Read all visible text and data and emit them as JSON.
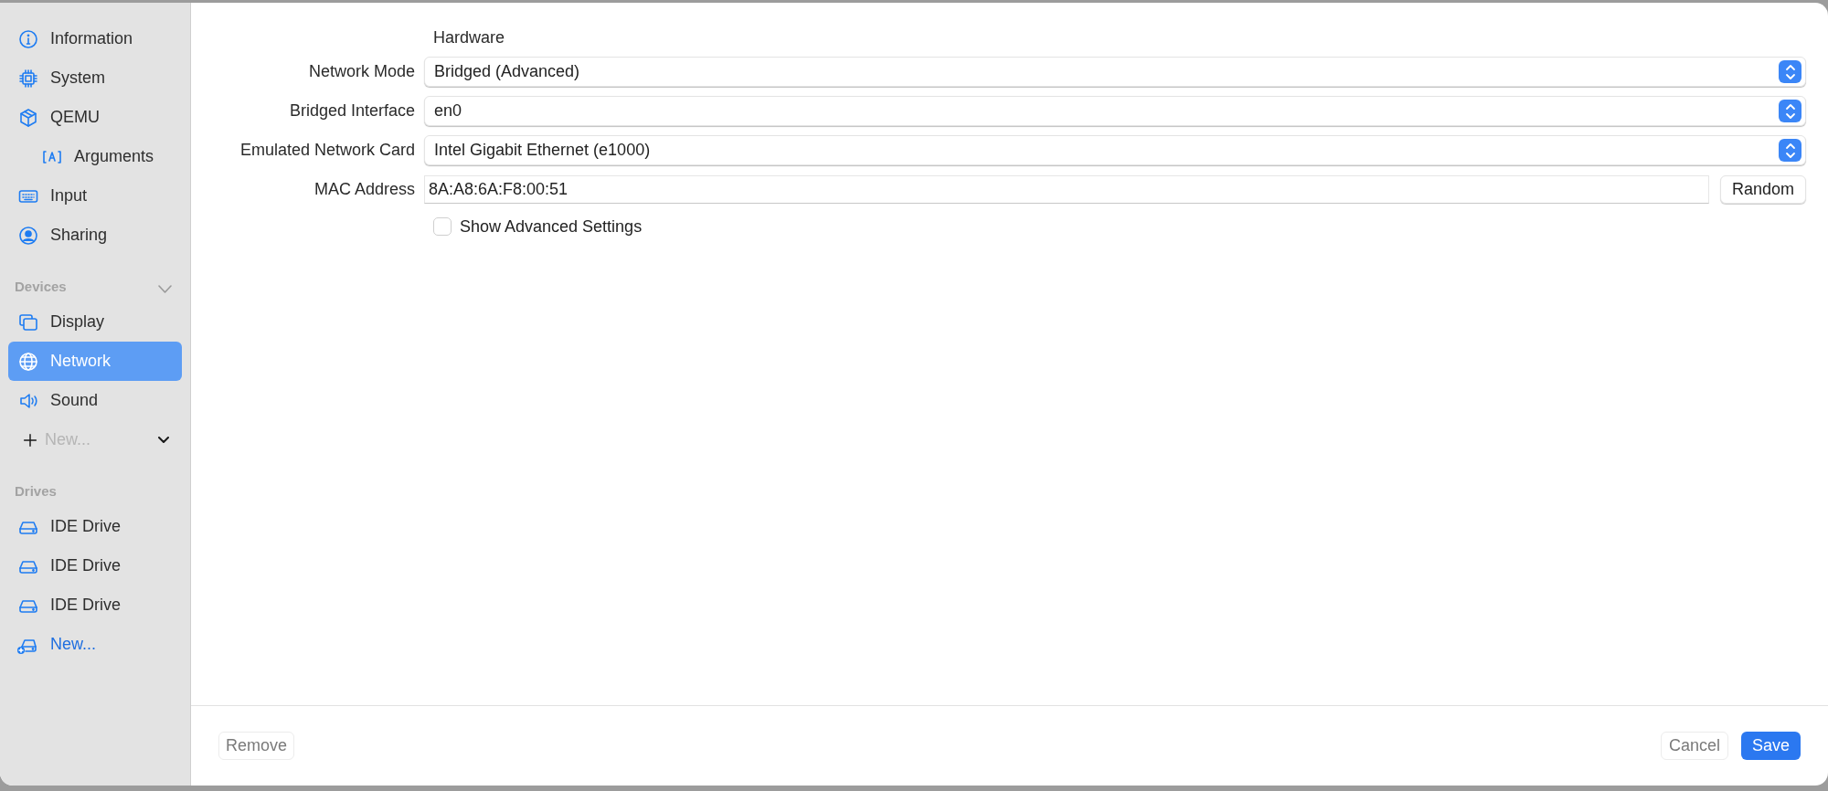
{
  "sidebar": {
    "items": [
      {
        "label": "Information",
        "selected": false
      },
      {
        "label": "System",
        "selected": false
      },
      {
        "label": "QEMU",
        "selected": false,
        "children": [
          {
            "label": "Arguments",
            "selected": false
          }
        ]
      },
      {
        "label": "Input",
        "selected": false
      },
      {
        "label": "Sharing",
        "selected": false
      }
    ],
    "sections": [
      {
        "title": "Devices",
        "expanded": true,
        "items": [
          {
            "label": "Display",
            "selected": false
          },
          {
            "label": "Network",
            "selected": true
          },
          {
            "label": "Sound",
            "selected": false
          }
        ],
        "add_menu": {
          "label": "New...",
          "disabled": true
        }
      },
      {
        "title": "Drives",
        "items": [
          {
            "label": "IDE Drive",
            "selected": false
          },
          {
            "label": "IDE Drive",
            "selected": false
          },
          {
            "label": "IDE Drive",
            "selected": false
          }
        ],
        "add_link": {
          "label": "New..."
        }
      }
    ]
  },
  "main": {
    "section_title": "Hardware",
    "fields": [
      {
        "kind": "popup",
        "label": "Network Mode",
        "value": "Bridged (Advanced)"
      },
      {
        "kind": "popup",
        "label": "Bridged Interface",
        "value": "en0"
      },
      {
        "kind": "popup",
        "label": "Emulated Network Card",
        "value": "Intel Gigabit Ethernet (e1000)"
      },
      {
        "kind": "text",
        "label": "MAC Address",
        "value": "8A:A8:6A:F8:00:51",
        "button": "Random"
      }
    ],
    "checkbox": {
      "label": "Show Advanced Settings",
      "checked": false
    }
  },
  "footer": {
    "remove": "Remove",
    "cancel": "Cancel",
    "save": "Save"
  }
}
